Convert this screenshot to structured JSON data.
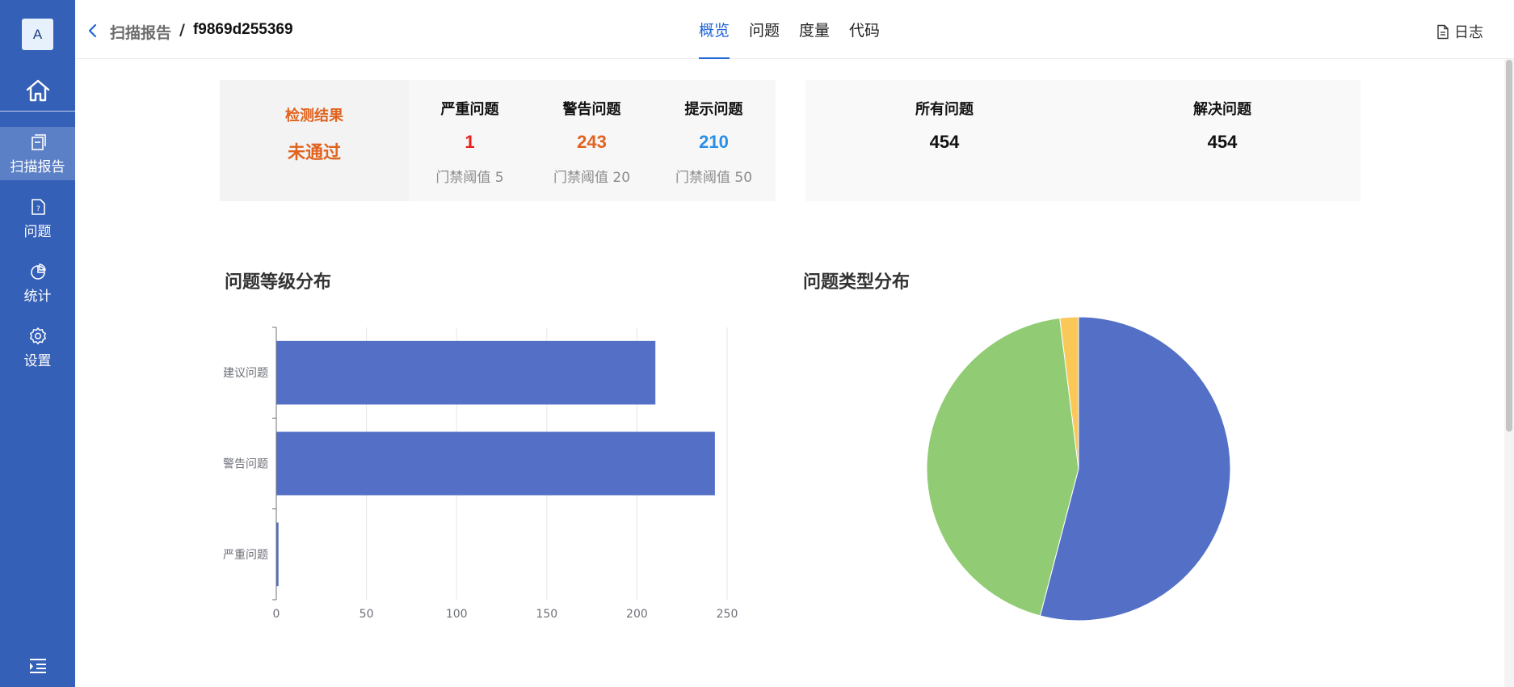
{
  "sidebar": {
    "avatar_letter": "A",
    "items": [
      {
        "label": "扫描报告",
        "icon": "report-icon",
        "active": true
      },
      {
        "label": "问题",
        "icon": "issue-file-icon"
      },
      {
        "label": "统计",
        "icon": "pie-chart-icon"
      },
      {
        "label": "设置",
        "icon": "gear-icon"
      }
    ]
  },
  "header": {
    "breadcrumb_parent": "扫描报告",
    "breadcrumb_separator": "/",
    "breadcrumb_current": "f9869d255369",
    "tabs": [
      {
        "label": "概览",
        "active": true
      },
      {
        "label": "问题"
      },
      {
        "label": "度量"
      },
      {
        "label": "代码"
      }
    ],
    "log_label": "日志"
  },
  "summary": {
    "result_label": "检测结果",
    "result_value": "未通过",
    "metrics": [
      {
        "label": "严重问题",
        "value": "1",
        "threshold": "门禁阈值 5",
        "color": "#e8201a"
      },
      {
        "label": "警告问题",
        "value": "243",
        "threshold": "门禁阈值 20",
        "color": "#e0631f"
      },
      {
        "label": "提示问题",
        "value": "210",
        "threshold": "门禁阈值 50",
        "color": "#2a8ee6"
      }
    ],
    "totals": [
      {
        "label": "所有问题",
        "value": "454"
      },
      {
        "label": "解决问题",
        "value": "454"
      }
    ]
  },
  "colors": {
    "primary": "#2266d6",
    "sidebar": "#3560b7",
    "bar": "#5470c6",
    "pie": [
      "#5470c6",
      "#91cc75",
      "#fac858"
    ]
  },
  "chart_data": [
    {
      "type": "bar",
      "orientation": "horizontal",
      "title": "问题等级分布",
      "categories": [
        "建议问题",
        "警告问题",
        "严重问题"
      ],
      "values": [
        210,
        243,
        1
      ],
      "xlim": [
        0,
        250
      ],
      "xticks": [
        "0",
        "50",
        "100",
        "150",
        "200",
        "250"
      ],
      "grid": true
    },
    {
      "type": "pie",
      "title": "问题类型分布",
      "values": [
        246,
        200,
        9
      ]
    }
  ]
}
